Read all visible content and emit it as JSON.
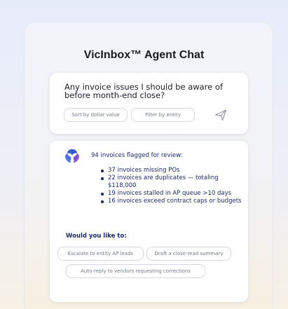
{
  "header": {
    "title": "VicInbox™ Agent Chat"
  },
  "query": {
    "text": "Any invoice issues I should be aware of before month-end close?",
    "chips": [
      "Sort by dollar value",
      "Filter by entity"
    ],
    "send_icon": "send-icon"
  },
  "response": {
    "logo_icon": "agent-logo-icon",
    "summary": "94 invoices flagged for review:",
    "bullets": [
      "37 invoices missing POs",
      "22 invoices are duplicates — totaling $118,000",
      "19 invoices stalled in AP queue >10 days",
      "16 invoices exceed contract caps or budgets"
    ],
    "prompt": "Would you like to:",
    "actions": [
      "Escalate to entity AP leads",
      "Draft a close-read summary",
      "Auto-reply to vendors requesting corrections"
    ]
  },
  "colors": {
    "accent": "#1a2a6c",
    "logo_blue": "#3a5bd9",
    "logo_purple": "#8a54d8"
  }
}
